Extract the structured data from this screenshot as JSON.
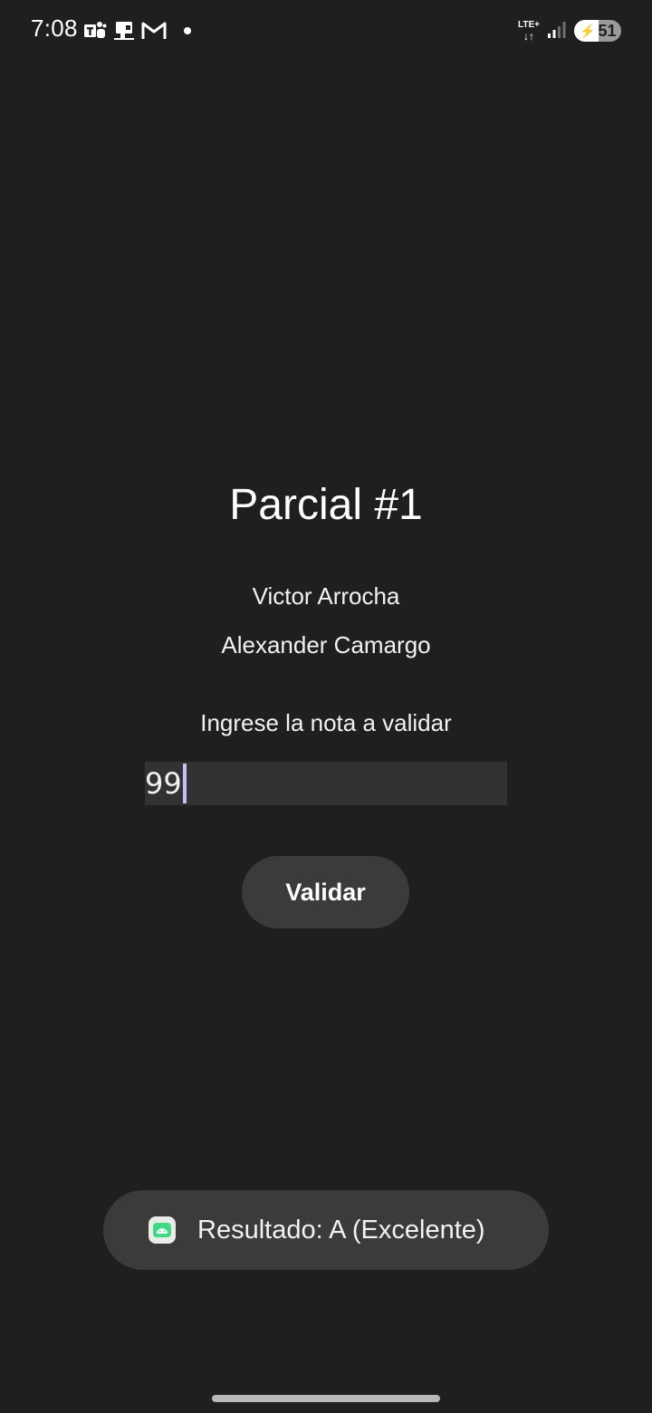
{
  "status_bar": {
    "time": "7:08",
    "left_icons": [
      "teams-icon",
      "toggl-icon",
      "gmail-icon",
      "notification-dot-icon"
    ],
    "network_type": "LTE+",
    "network_arrows": "↓↑",
    "battery_level": "51",
    "battery_fraction": 0.51,
    "charging": true
  },
  "main": {
    "title": "Parcial #1",
    "authors": [
      "Victor Arrocha",
      "Alexander Camargo"
    ],
    "prompt": "Ingrese la nota a validar",
    "grade_input_value": "99",
    "validate_button_label": "Validar"
  },
  "toast": {
    "icon": "android-app-icon",
    "message": "Resultado: A (Excelente)"
  },
  "colors": {
    "background": "#1f1f1f",
    "input_background": "#323232",
    "button_background": "#3b3b3b",
    "cursor": "#c8bdf5",
    "toast_icon_green": "#3ddc84"
  }
}
